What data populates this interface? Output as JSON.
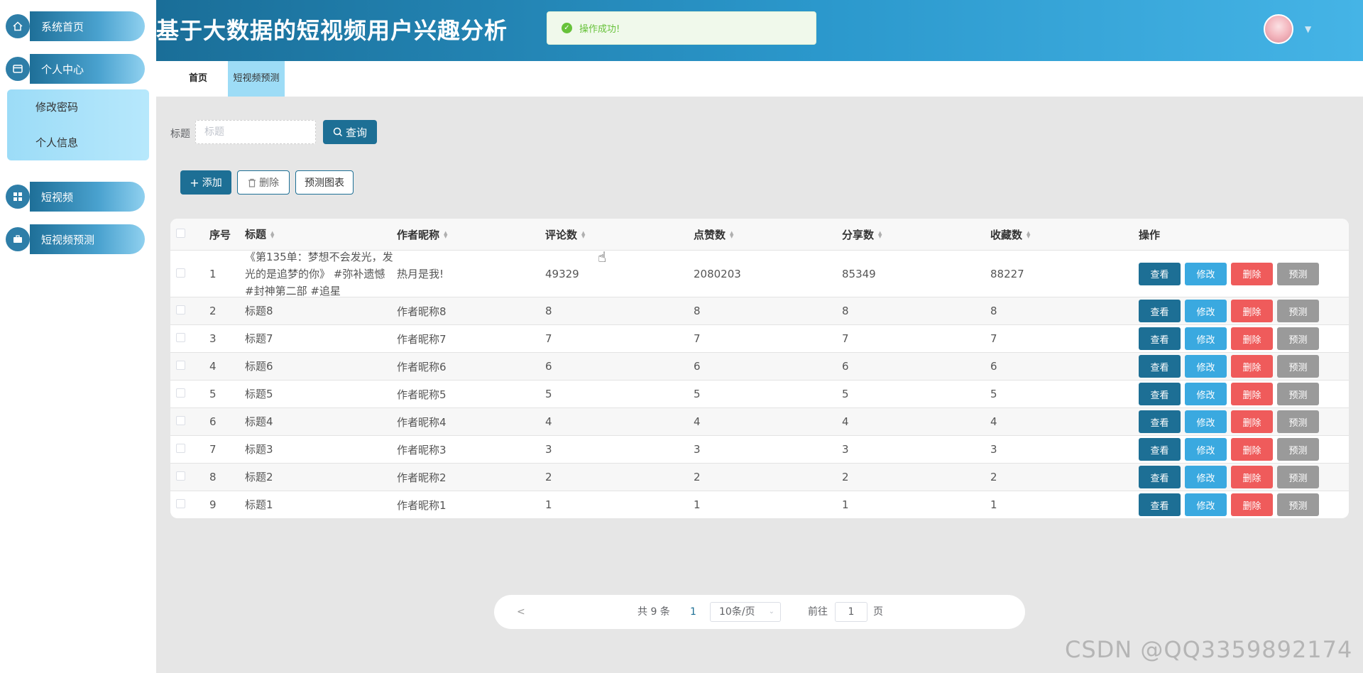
{
  "app": {
    "title": "基于大数据的短视频用户兴趣分析",
    "toast": "操作成功!"
  },
  "sidebar": {
    "items": [
      {
        "label": "系统首页",
        "icon": "home-icon"
      },
      {
        "label": "个人中心",
        "icon": "wallet-icon"
      },
      {
        "label": "短视频",
        "icon": "grid-icon"
      },
      {
        "label": "短视频预测",
        "icon": "briefcase-icon"
      }
    ],
    "submenu": [
      {
        "label": "修改密码"
      },
      {
        "label": "个人信息"
      }
    ]
  },
  "tabs": [
    {
      "label": "首页"
    },
    {
      "label": "短视频预测"
    }
  ],
  "search": {
    "label": "标题",
    "placeholder": "标题",
    "button": "查询"
  },
  "actions": {
    "add": "添加",
    "delete": "删除",
    "chart": "预测图表"
  },
  "table": {
    "columns": [
      "序号",
      "标题",
      "作者昵称",
      "评论数",
      "点赞数",
      "分享数",
      "收藏数",
      "操作"
    ],
    "ops": [
      "查看",
      "修改",
      "删除",
      "预测"
    ],
    "rows": [
      {
        "idx": "1",
        "title": "《第135单：梦想不会发光，发光的是追梦的你》 #弥补遗憾 #封神第二部 #追星",
        "author": "热月是我!",
        "comments": "49329",
        "likes": "2080203",
        "shares": "85349",
        "favs": "88227"
      },
      {
        "idx": "2",
        "title": "标题8",
        "author": "作者昵称8",
        "comments": "8",
        "likes": "8",
        "shares": "8",
        "favs": "8"
      },
      {
        "idx": "3",
        "title": "标题7",
        "author": "作者昵称7",
        "comments": "7",
        "likes": "7",
        "shares": "7",
        "favs": "7"
      },
      {
        "idx": "4",
        "title": "标题6",
        "author": "作者昵称6",
        "comments": "6",
        "likes": "6",
        "shares": "6",
        "favs": "6"
      },
      {
        "idx": "5",
        "title": "标题5",
        "author": "作者昵称5",
        "comments": "5",
        "likes": "5",
        "shares": "5",
        "favs": "5"
      },
      {
        "idx": "6",
        "title": "标题4",
        "author": "作者昵称4",
        "comments": "4",
        "likes": "4",
        "shares": "4",
        "favs": "4"
      },
      {
        "idx": "7",
        "title": "标题3",
        "author": "作者昵称3",
        "comments": "3",
        "likes": "3",
        "shares": "3",
        "favs": "3"
      },
      {
        "idx": "8",
        "title": "标题2",
        "author": "作者昵称2",
        "comments": "2",
        "likes": "2",
        "shares": "2",
        "favs": "2"
      },
      {
        "idx": "9",
        "title": "标题1",
        "author": "作者昵称1",
        "comments": "1",
        "likes": "1",
        "shares": "1",
        "favs": "1"
      }
    ]
  },
  "pagination": {
    "prev": "<",
    "total": "共 9 条",
    "current": "1",
    "size": "10条/页",
    "goto": "前往",
    "page_input": "1",
    "unit": "页"
  },
  "watermark": "CSDN @QQ3359892174",
  "colors": {
    "primary": "#1d6f95",
    "edit": "#3aa9e0",
    "danger": "#ef5b5b",
    "predict": "#9a9a9a",
    "success": "#67c23a"
  }
}
